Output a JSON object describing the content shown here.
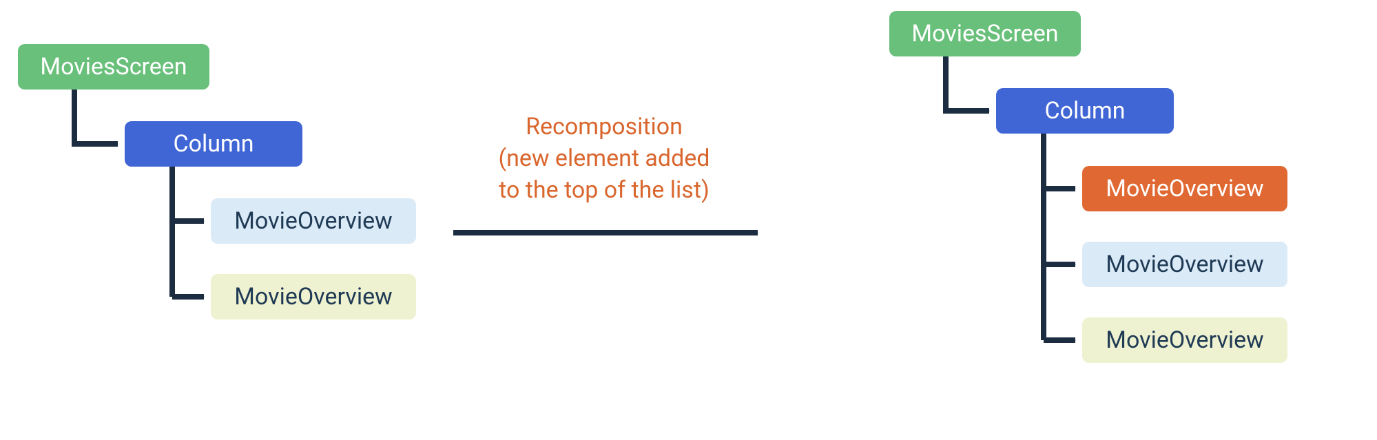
{
  "colors": {
    "green": "#69c07b",
    "blue": "#4066d5",
    "lightblue": "#daeaf7",
    "lightyellow": "#eff2d0",
    "orange_fill": "#e06933",
    "text_dark": "#1f3a55",
    "caption": "#d9662d",
    "stroke": "#1c2d41"
  },
  "left_tree": {
    "root": "MoviesScreen",
    "column": "Column",
    "children": [
      {
        "label": "MovieOverview",
        "style": "lightblue"
      },
      {
        "label": "MovieOverview",
        "style": "lightyellow"
      }
    ]
  },
  "right_tree": {
    "root": "MoviesScreen",
    "column": "Column",
    "children": [
      {
        "label": "MovieOverview",
        "style": "orange"
      },
      {
        "label": "MovieOverview",
        "style": "lightblue"
      },
      {
        "label": "MovieOverview",
        "style": "lightyellow"
      }
    ]
  },
  "caption": {
    "line1": "Recomposition",
    "line2": "(new element added",
    "line3": "to the top of the list)"
  }
}
